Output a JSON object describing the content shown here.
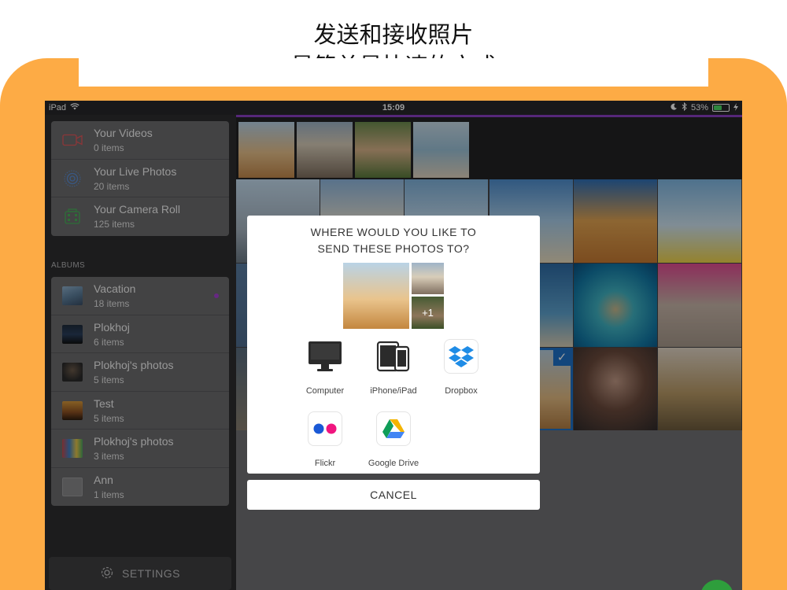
{
  "promo": {
    "line1": "发送和接收照片",
    "line2": "最简单最快速的方式"
  },
  "colors": {
    "frame": "#fdab45",
    "accent": "#8b3fc3",
    "selection": "#1e72c8",
    "fab": "#2e9e3c"
  },
  "status_bar": {
    "device": "iPad",
    "time": "15:09",
    "battery": "53%",
    "battery_level": 0.53,
    "icons": [
      "wifi-icon",
      "moon-icon",
      "bluetooth-icon",
      "battery-icon",
      "charging-icon"
    ]
  },
  "sidebar": {
    "sources": [
      {
        "title": "Your Videos",
        "count": "0 items",
        "icon": "video-camera-icon"
      },
      {
        "title": "Your Live Photos",
        "count": "20 items",
        "icon": "live-photo-icon"
      },
      {
        "title": "Your Camera Roll",
        "count": "125 items",
        "icon": "camera-roll-icon"
      }
    ],
    "albums_heading": "ALBUMS",
    "albums": [
      {
        "title": "Vacation",
        "count": "18 items"
      },
      {
        "title": "Plokhoj",
        "count": "6 items"
      },
      {
        "title": "Plokhoj's photos",
        "count": "5 items"
      },
      {
        "title": "Test",
        "count": "5 items"
      },
      {
        "title": "Plokhoj's photos",
        "count": "3 items"
      },
      {
        "title": "Ann",
        "count": "1 items"
      }
    ],
    "settings_label": "SETTINGS"
  },
  "modal": {
    "title_line1": "WHERE WOULD YOU LIKE TO",
    "title_line2": "SEND THESE PHOTOS TO?",
    "extra_count": "+1",
    "targets": [
      {
        "label": "Computer",
        "icon": "computer-icon"
      },
      {
        "label": "iPhone/iPad",
        "icon": "iphone-ipad-icon"
      },
      {
        "label": "Dropbox",
        "icon": "dropbox-icon"
      },
      {
        "label": "Flickr",
        "icon": "flickr-icon"
      },
      {
        "label": "Google Drive",
        "icon": "google-drive-icon"
      }
    ],
    "cancel_label": "CANCEL"
  }
}
